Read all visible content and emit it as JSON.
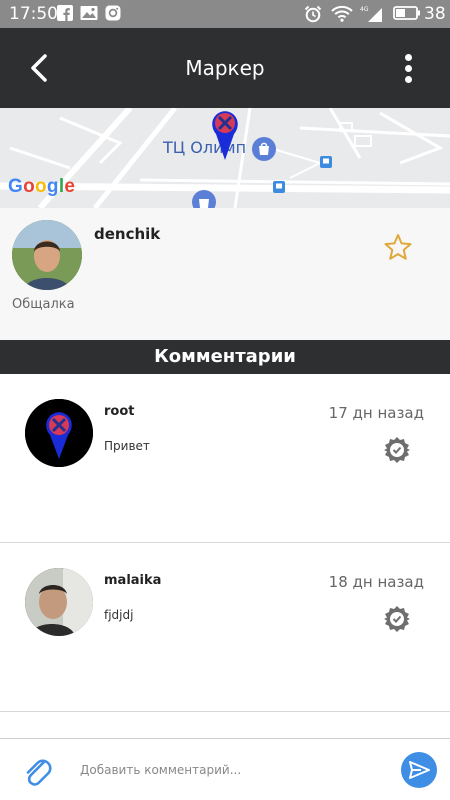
{
  "status_bar": {
    "time": "17:50",
    "battery": "38",
    "network": "4G"
  },
  "app_bar": {
    "title": "Маркер"
  },
  "map": {
    "place_label": "ТЦ Олимп",
    "logo": {
      "letters": [
        "G",
        "o",
        "o",
        "g",
        "l",
        "e"
      ],
      "colors": [
        "#4285F4",
        "#EA4335",
        "#FBBC05",
        "#4285F4",
        "#34A853",
        "#EA4335"
      ]
    }
  },
  "profile": {
    "username": "denchik",
    "group": "Общалка"
  },
  "comments_section": {
    "title": "Комментарии",
    "items": [
      {
        "author": "root",
        "text": "Привет",
        "time": "17 дн назад"
      },
      {
        "author": "malaika",
        "text": "fjdjdj",
        "time": "18 дн назад"
      }
    ]
  },
  "input": {
    "placeholder": "Добавить комментарий..."
  },
  "colors": {
    "status_bar": "#8a8a8a",
    "app_bar": "#2e2f31",
    "send_button": "#3f8ee5",
    "star": "#e0a83b"
  }
}
